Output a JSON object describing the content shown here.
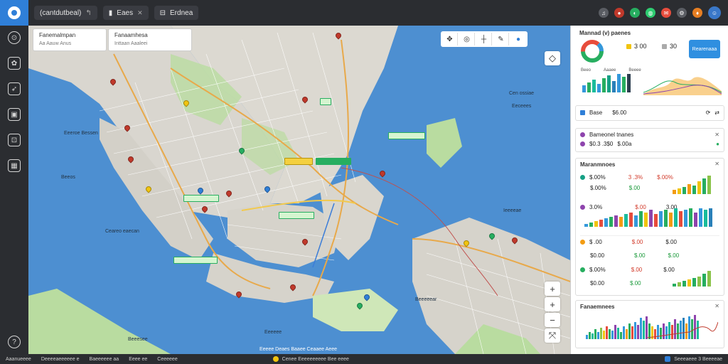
{
  "titlebar": {
    "tabs": [
      {
        "label": "(cantdutbeal)"
      },
      {
        "label": "Eaes"
      },
      {
        "label": "Erdnea"
      }
    ]
  },
  "top_icons": [
    {
      "name": "bell-icon",
      "color": "#5a5d63"
    },
    {
      "name": "alert-icon",
      "color": "#c0392b"
    },
    {
      "name": "globe-icon",
      "color": "#27ae60"
    },
    {
      "name": "chat-icon",
      "color": "#2ecc71"
    },
    {
      "name": "notification-icon",
      "color": "#e74c3c"
    },
    {
      "name": "settings-icon",
      "color": "#5a5d63"
    },
    {
      "name": "profile-icon",
      "color": "#e67e22"
    }
  ],
  "sidebar_icons": [
    "dashboard-icon",
    "layers-icon",
    "route-icon",
    "map-icon",
    "report-icon",
    "grid-icon",
    "help-icon"
  ],
  "map": {
    "card1": {
      "title": "Fanemalmpan",
      "sub": "Aa   Aauw   Anus"
    },
    "card2": {
      "title": "Fanaamhesa",
      "sub": "Inttaan  Aaaleei"
    },
    "zoom_in": "+",
    "zoom_out": "−",
    "compass": "+",
    "labels": [
      {
        "text": "Eeeroe Bessen",
        "cls": "l1"
      },
      {
        "text": "Ceareo eaecan",
        "cls": "l2"
      },
      {
        "text": "Beeos",
        "cls": "l3"
      },
      {
        "text": "Cen ossiae",
        "cls": "l4"
      },
      {
        "text": "Eeceees",
        "cls": "l5"
      },
      {
        "text": "Ieeeeae",
        "cls": "l6"
      },
      {
        "text": "Eeeeee",
        "cls": "l7"
      },
      {
        "text": "Beeeeear",
        "cls": "l8"
      },
      {
        "text": "Beeesee",
        "cls": "l9"
      }
    ],
    "footer": "Eeeee  Deaes  Baaee  Ceaaee  Aeee"
  },
  "right": {
    "summary_title": "Mannad (v) paenes",
    "stat1": "3 00",
    "stat2": "30",
    "cta": "Rearenaaa",
    "legend": [
      "Beeo",
      "Aaaee",
      "Beeee"
    ],
    "filter": {
      "a": "Base",
      "b": "$6.00"
    },
    "event": {
      "title": "Bameonel tnanes",
      "v1": "$0.3 .3$0",
      "v2": "$.00a"
    },
    "panel3": {
      "title": "Maranmnoes",
      "rows": [
        {
          "a": "$.00%",
          "b": "3 .3%",
          "c": "$.00%",
          "d": "$.00"
        },
        {
          "a": "3.0%",
          "b": "$.00",
          "c": "3.00"
        },
        {
          "a": "$ .00",
          "b": "$.00",
          "c": "$.00",
          "d": "$0.00"
        },
        {
          "a": "$.00%",
          "b": "$.00",
          "c": "$.00",
          "d": "$0.00"
        }
      ]
    },
    "panel4": {
      "title": "Fanaemnees"
    }
  },
  "bottombar": [
    "Aaanueeee",
    "Deeeeaeeeeee e",
    "Baeeeeee aa",
    "Eeee ee",
    "Ceeeeee"
  ],
  "bottom_status": "Cenee  Eeeeeeeeee  Bee eeee",
  "bottom_right": "Seeeaeee 3 Beeeeae"
}
